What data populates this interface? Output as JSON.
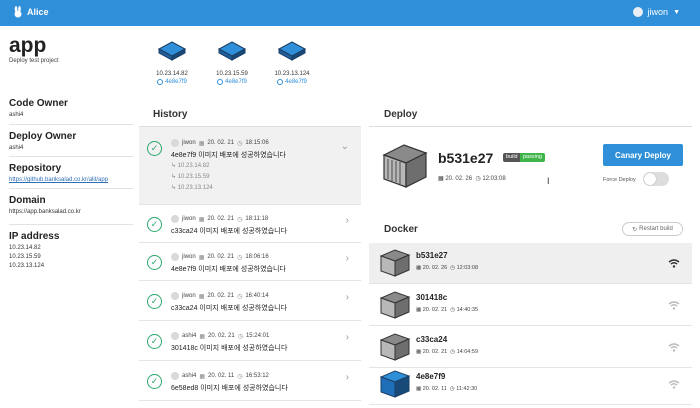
{
  "header": {
    "logo_text": "Alice",
    "user_name": "jiwon",
    "icon": "rabbit-icon"
  },
  "app": {
    "name": "app",
    "description": "Deploy test project"
  },
  "sidebar": {
    "code_owner": {
      "label": "Code Owner",
      "value": "ashi4"
    },
    "deploy_owner": {
      "label": "Deploy Owner",
      "value": "ashi4"
    },
    "repository": {
      "label": "Repository",
      "value": "https://github.banksalad.co.kr/alit/app"
    },
    "domain": {
      "label": "Domain",
      "value": "https://app.banksalad.co.kr"
    },
    "ip_address": {
      "label": "IP address",
      "values": [
        "10.23.14.82",
        "10.23.15.59",
        "10.23.13.124"
      ]
    }
  },
  "servers": [
    {
      "ip": "10.23.14.82",
      "hash": "4e8e7f9"
    },
    {
      "ip": "10.23.15.59",
      "hash": "4e8e7f9"
    },
    {
      "ip": "10.23.13.124",
      "hash": "4e8e7f9"
    }
  ],
  "history": {
    "title": "History",
    "items": [
      {
        "user": "jiwon",
        "date": "20. 02. 21",
        "time": "18:15:06",
        "message": "4e8e7f9 이미지 배포에 성공하였습니다",
        "expanded": true,
        "targets": [
          "10.23.14.82",
          "10.23.15.59",
          "10.23.13.124"
        ]
      },
      {
        "user": "jiwon",
        "date": "20. 02. 21",
        "time": "18:11:18",
        "message": "c33ca24 이미지 배포에 성공하였습니다"
      },
      {
        "user": "jiwon",
        "date": "20. 02. 21",
        "time": "18:06:16",
        "message": "4e8e7f9 이미지 배포에 성공하였습니다"
      },
      {
        "user": "jiwon",
        "date": "20. 02. 21",
        "time": "16:40:14",
        "message": "c33ca24 이미지 배포에 성공하였습니다"
      },
      {
        "user": "ashi4",
        "date": "20. 02. 21",
        "time": "15:24:01",
        "message": "301418c 이미지 배포에 성공하였습니다"
      },
      {
        "user": "ashi4",
        "date": "20. 02. 11",
        "time": "16:53:12",
        "message": "6e58ed8 이미지 배포에 성공하였습니다"
      }
    ]
  },
  "deploy": {
    "title": "Deploy",
    "hash": "b531e27",
    "badge_label": "build",
    "badge_status": "passing",
    "date": "20. 02. 26",
    "time": "12:03:08",
    "canary_button": "Canary Deploy",
    "force_label": "Force Deploy",
    "force_on": false
  },
  "docker": {
    "title": "Docker",
    "restart_button": "Restart build",
    "items": [
      {
        "name": "b531e27",
        "date": "20. 02. 26",
        "time": "12:03:08",
        "active": true,
        "deployed": false
      },
      {
        "name": "301418c",
        "date": "20. 02. 21",
        "time": "14:40:35",
        "active": false,
        "deployed": false
      },
      {
        "name": "c33ca24",
        "date": "20. 02. 21",
        "time": "14:04:59",
        "active": false,
        "deployed": false
      },
      {
        "name": "4e8e7f9",
        "date": "20. 02. 11",
        "time": "11:42:30",
        "active": false,
        "deployed": true
      }
    ]
  },
  "colors": {
    "primary": "#2f8fd8",
    "success": "#2aa86d",
    "badge_green": "#3db54a"
  }
}
